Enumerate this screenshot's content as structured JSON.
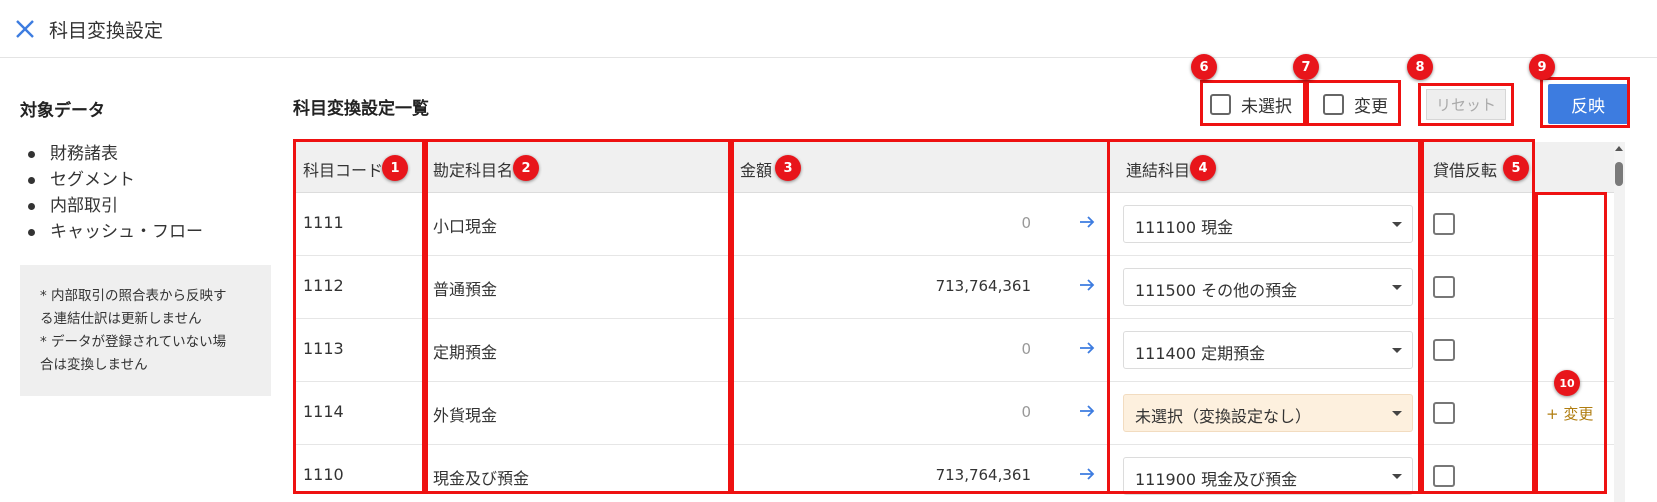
{
  "header": {
    "title": "科目変換設定"
  },
  "sidebar": {
    "title": "対象データ",
    "items": [
      "財務諸表",
      "セグメント",
      "内部取引",
      "キャッシュ・フロー"
    ],
    "notes": [
      "* 内部取引の照合表から反映す",
      "る連結仕訳は更新しません",
      "* データが登録されていない場",
      "合は変換しません"
    ]
  },
  "main": {
    "title": "科目変換設定一覧",
    "filters": {
      "unselected_label": "未選択",
      "changed_label": "変更"
    },
    "reset_label": "リセット",
    "apply_label": "反映",
    "table": {
      "headers": {
        "code": "科目コード",
        "name": "勘定科目名",
        "amount": "金額",
        "linked": "連結科目",
        "reverse": "貸借反転"
      },
      "rows": [
        {
          "code": "1111",
          "name": "小口現金",
          "amount": "0",
          "linked": "111100 現金",
          "reverse": false
        },
        {
          "code": "1112",
          "name": "普通預金",
          "amount": "713,764,361",
          "linked": "111500 その他の預金",
          "reverse": false
        },
        {
          "code": "1113",
          "name": "定期預金",
          "amount": "0",
          "linked": "111400 定期預金",
          "reverse": false
        },
        {
          "code": "1114",
          "name": "外貨現金",
          "amount": "0",
          "linked": "未選択（変換設定なし）",
          "reverse": false,
          "action": "+ 変更"
        },
        {
          "code": "1110",
          "name": "現金及び預金",
          "amount": "713,764,361",
          "linked": "111900 現金及び預金",
          "reverse": false
        }
      ]
    }
  },
  "annotations": [
    "1",
    "2",
    "3",
    "4",
    "5",
    "6",
    "7",
    "8",
    "9",
    "10"
  ],
  "colors": {
    "accent": "#3d7ce0",
    "annotation": "#e8151b",
    "unset_select_bg": "#fdf0de",
    "change_link": "#b07d10"
  }
}
